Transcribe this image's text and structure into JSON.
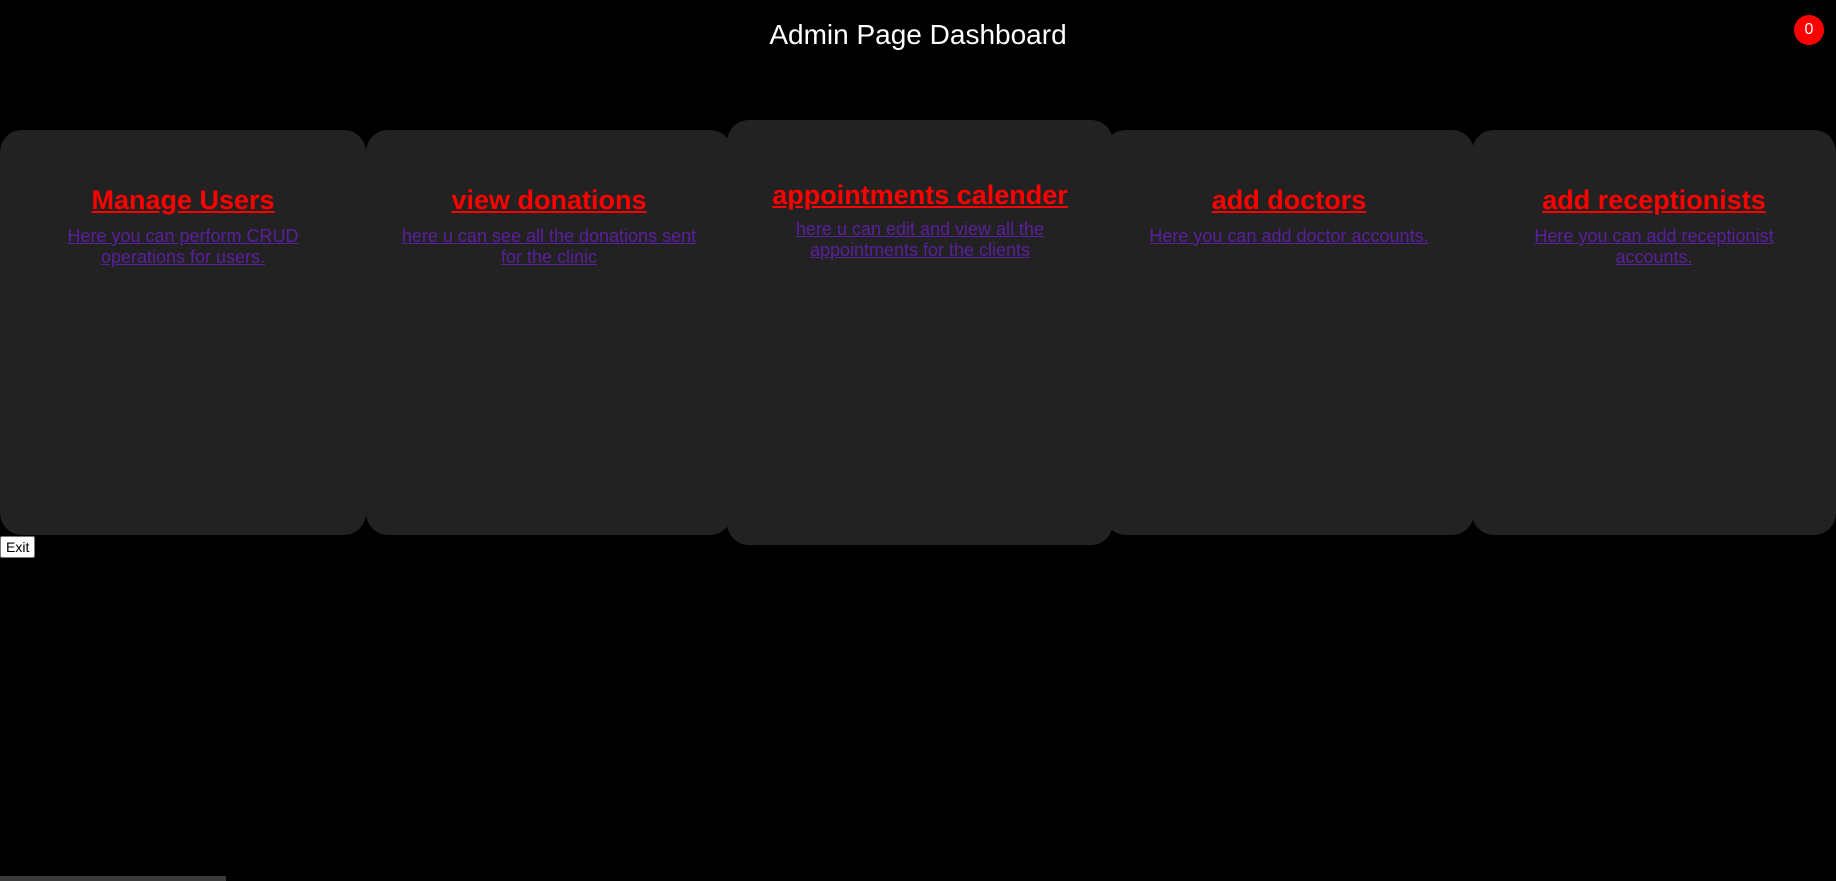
{
  "header": {
    "title": "Admin Page Dashboard",
    "notification_count": "0"
  },
  "cards": [
    {
      "title": "Manage Users",
      "description": "Here you can perform CRUD operations for users."
    },
    {
      "title": "view donations",
      "description": "here u can see all the donations sent for the clinic"
    },
    {
      "title": "appointments calender",
      "description": "here u can edit and view all the appointments for the clients"
    },
    {
      "title": "add doctors",
      "description": "Here you can add doctor accounts."
    },
    {
      "title": "add receptionists",
      "description": "Here you can add receptionist accounts."
    }
  ],
  "footer": {
    "exit_label": "Exit"
  },
  "colors": {
    "background": "#000000",
    "card_background": "#222222",
    "title_link": "#ff0000",
    "description_link": "#5b1f9e",
    "badge": "#ff0000"
  }
}
